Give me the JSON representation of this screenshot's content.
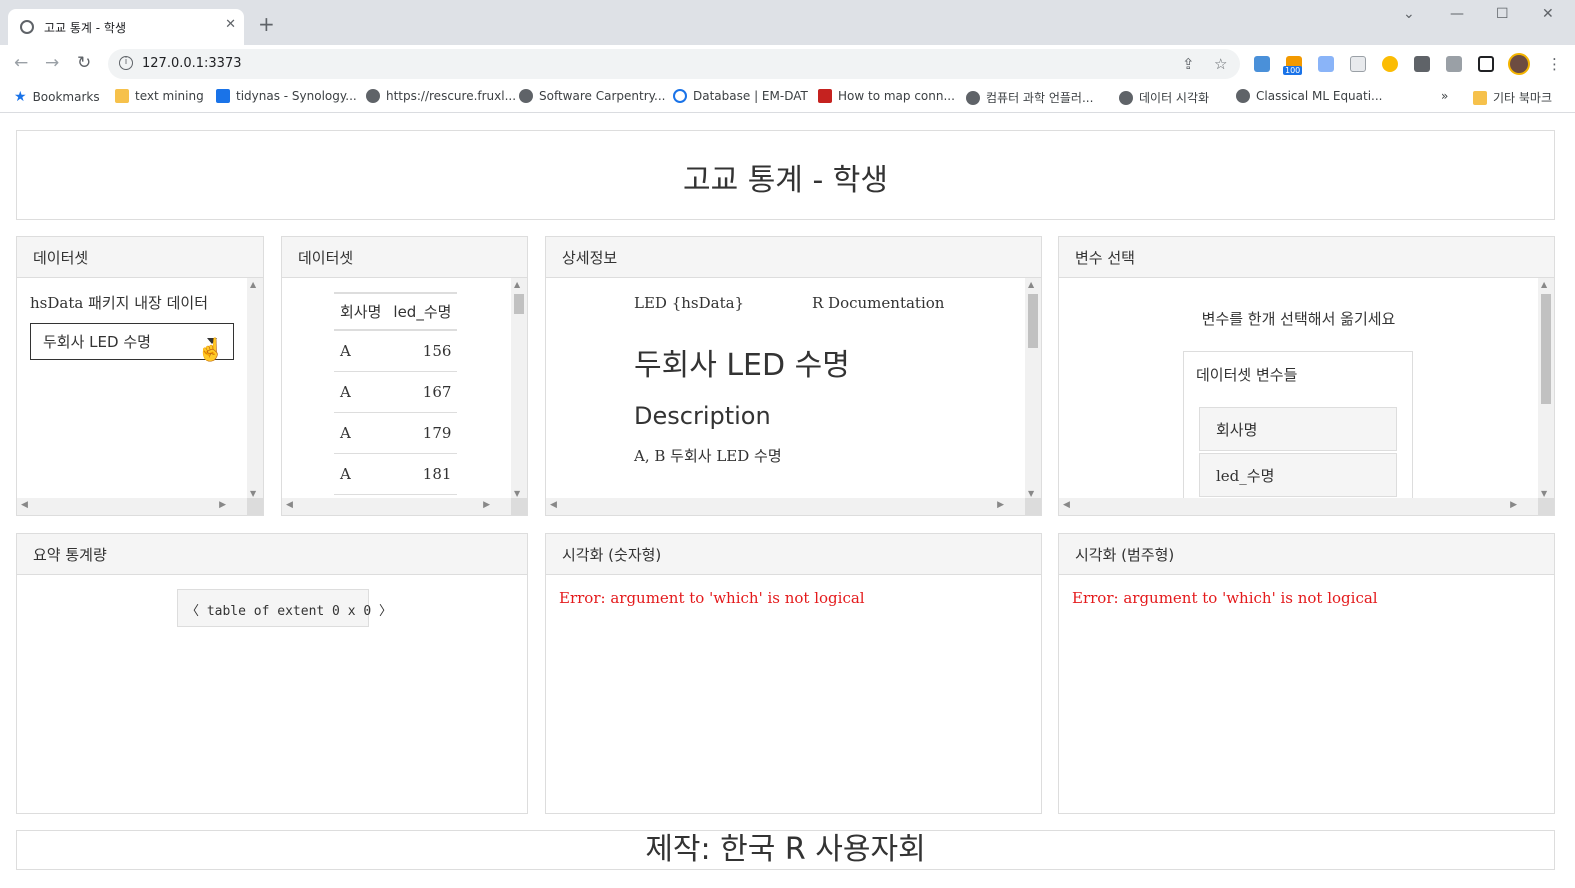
{
  "browser": {
    "tab_title": "고교 통계 - 학생",
    "tab_close": "✕",
    "new_tab": "+",
    "url": "127.0.0.1:3373",
    "ext_badge": "100",
    "window": {
      "minimize": "—",
      "maximize": "☐",
      "close": "✕",
      "tabsearch": "⌄"
    },
    "nav": {
      "back": "←",
      "forward": "→",
      "reload": "↻"
    },
    "bookmarks": [
      "Bookmarks",
      "text mining",
      "tidynas - Synology...",
      "https://rescure.fruxl...",
      "Software Carpentry...",
      "Database | EM-DAT",
      "How to map conn...",
      "컴퓨터 과학 언플러...",
      "데이터 시각화",
      "Classical ML Equati...",
      "기타 북마크"
    ],
    "bookmarks_more": "»"
  },
  "app": {
    "title": "고교 통계 - 학생",
    "footer": "제작: 한국 R 사용자회"
  },
  "dataset_panel": {
    "header": "데이터셋",
    "label": "hsData 패키지 내장 데이터",
    "selected": "두회사 LED 수명"
  },
  "table_panel": {
    "header": "데이터셋",
    "columns": [
      "회사명",
      "led_수명"
    ],
    "rows": [
      [
        "A",
        "156"
      ],
      [
        "A",
        "167"
      ],
      [
        "A",
        "179"
      ],
      [
        "A",
        "181"
      ]
    ]
  },
  "detail_panel": {
    "header": "상세정보",
    "meta_left": "LED {hsData}",
    "meta_right": "R Documentation",
    "title": "두회사 LED 수명",
    "section": "Description",
    "desc": "A, B 두회사 LED 수명"
  },
  "variable_panel": {
    "header": "변수 선택",
    "hint": "변수를 한개 선택해서 옮기세요",
    "box_title": "데이터셋 변수들",
    "items": [
      "회사명",
      "led_수명"
    ]
  },
  "summary_panel": {
    "header": "요약 통계량",
    "button": "〈 table of extent 0 x 0 〉"
  },
  "num_viz_panel": {
    "header": "시각화 (숫자형)",
    "error_label": "Error:",
    "error_msg": "argument to 'which' is not logical"
  },
  "cat_viz_panel": {
    "header": "시각화 (범주형)",
    "error_label": "Error:",
    "error_msg": "argument to 'which' is not logical"
  }
}
